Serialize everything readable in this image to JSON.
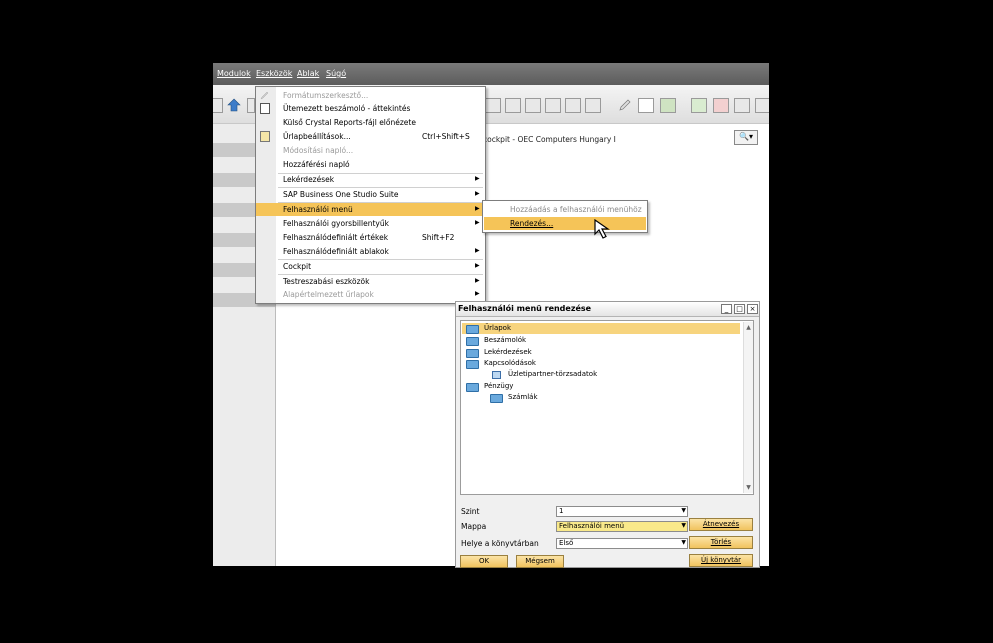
{
  "menubar": {
    "items": [
      "Modulok",
      "Eszközök",
      "Ablak",
      "Súgó"
    ]
  },
  "workspace": {
    "cockpit_title": "cockpit - OEC Computers Hungary I",
    "search_button": "🔍▾"
  },
  "dropdown": {
    "items": [
      {
        "label": "Formátumszerkesztő...",
        "disabled": true
      },
      {
        "label": "Ütemezett beszámoló - áttekintés",
        "disabled": false
      },
      {
        "label": "Külső Crystal Reports-fájl előnézete",
        "disabled": false
      },
      {
        "label": "Űrlapbeállítások...",
        "shortcut": "Ctrl+Shift+S",
        "disabled": false
      },
      {
        "label": "Módosítási napló...",
        "disabled": true
      },
      {
        "label": "Hozzáférési napló",
        "disabled": false
      },
      {
        "label": "Lekérdezések",
        "submenu": true
      },
      {
        "label": "SAP Business One Studio Suite",
        "submenu": true
      },
      {
        "label": "Felhasználói menü",
        "submenu": true,
        "highlighted": true
      },
      {
        "label": "Felhasználói gyorsbillentyűk",
        "submenu": true
      },
      {
        "label": "Felhasználódefiniált értékek",
        "shortcut": "Shift+F2"
      },
      {
        "label": "Felhasználódefiniált ablakok",
        "submenu": true
      },
      {
        "label": "Cockpit",
        "submenu": true
      },
      {
        "label": "Testreszabási eszközök",
        "submenu": true
      },
      {
        "label": "Alapértelmezett űrlapok",
        "submenu": true,
        "disabled": true
      }
    ]
  },
  "submenu": {
    "items": [
      {
        "label": "Hozzáadás a felhasználói menühöz",
        "disabled": true
      },
      {
        "label": "Rendezés...",
        "highlighted": true
      }
    ]
  },
  "dialog": {
    "title": "Felhasználói menü rendezése",
    "window_buttons": [
      "_",
      "□",
      "×"
    ],
    "tree": [
      {
        "label": "Űrlapok",
        "icon": "folder-icon",
        "level": 0,
        "selected": true
      },
      {
        "label": "Beszámolók",
        "icon": "folder-icon",
        "level": 0
      },
      {
        "label": "Lekérdezések",
        "icon": "folder-icon",
        "level": 0
      },
      {
        "label": "Kapcsolódások",
        "icon": "folder-icon",
        "level": 0
      },
      {
        "label": "Üzletipartner-törzsadatok",
        "icon": "document-icon",
        "level": 1
      },
      {
        "label": "Pénzügy",
        "icon": "folder-icon",
        "level": 0
      },
      {
        "label": "Számlák",
        "icon": "folder-icon",
        "level": 1
      }
    ],
    "fields": {
      "szint_label": "Szint",
      "szint_value": "1",
      "mappa_label": "Mappa",
      "mappa_value": "Felhasználói menü",
      "helye_label": "Helye a könyvtárban",
      "helye_value": "Első"
    },
    "buttons": {
      "rename": "Átnevezés",
      "delete": "Törlés",
      "ok": "OK",
      "cancel": "Mégsem",
      "new_folder": "Új könyvtár"
    }
  },
  "colors": {
    "highlight": "#f5c458",
    "menubar": "#6a6a6a"
  }
}
